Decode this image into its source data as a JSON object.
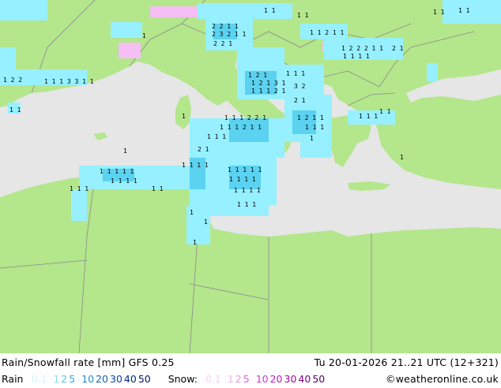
{
  "title": "Rain/Snowfall rate [mm] GFS 0.25",
  "datetime": "Tu 20-01-2026 21..21 UTC (12+321)",
  "credit": "©weatheronline.co.uk",
  "legend": {
    "rain_label": "Rain",
    "rain_steps": [
      {
        "v": "0.1",
        "color": "#d2f5fa"
      },
      {
        "v": "1",
        "color": "#7fe0f0"
      },
      {
        "v": "2",
        "color": "#50c8e6"
      },
      {
        "v": "5",
        "color": "#28aadc"
      },
      {
        "v": "10",
        "color": "#1e8cc8"
      },
      {
        "v": "20",
        "color": "#1464b4"
      },
      {
        "v": "30",
        "color": "#0a46a0"
      },
      {
        "v": "40",
        "color": "#002a82"
      },
      {
        "v": "50",
        "color": "#001464"
      }
    ],
    "snow_label": "Snow:",
    "snow_steps": [
      {
        "v": "0.1",
        "color": "#f5d2f5"
      },
      {
        "v": "1",
        "color": "#f0b4f0"
      },
      {
        "v": "2",
        "color": "#e696e6"
      },
      {
        "v": "5",
        "color": "#dc64dc"
      },
      {
        "v": "10",
        "color": "#c83cc8"
      },
      {
        "v": "20",
        "color": "#b41eb4"
      },
      {
        "v": "30",
        "color": "#960a96"
      },
      {
        "v": "40",
        "color": "#780078"
      },
      {
        "v": "50",
        "color": "#5a005a"
      }
    ]
  },
  "colors": {
    "land": "#b4e68c",
    "sea": "#e6e6e6",
    "border": "#8a8a8a",
    "rain_light": "#96f0ff",
    "rain_medium": "#5ad2f0",
    "snow": "#f5bef5"
  }
}
